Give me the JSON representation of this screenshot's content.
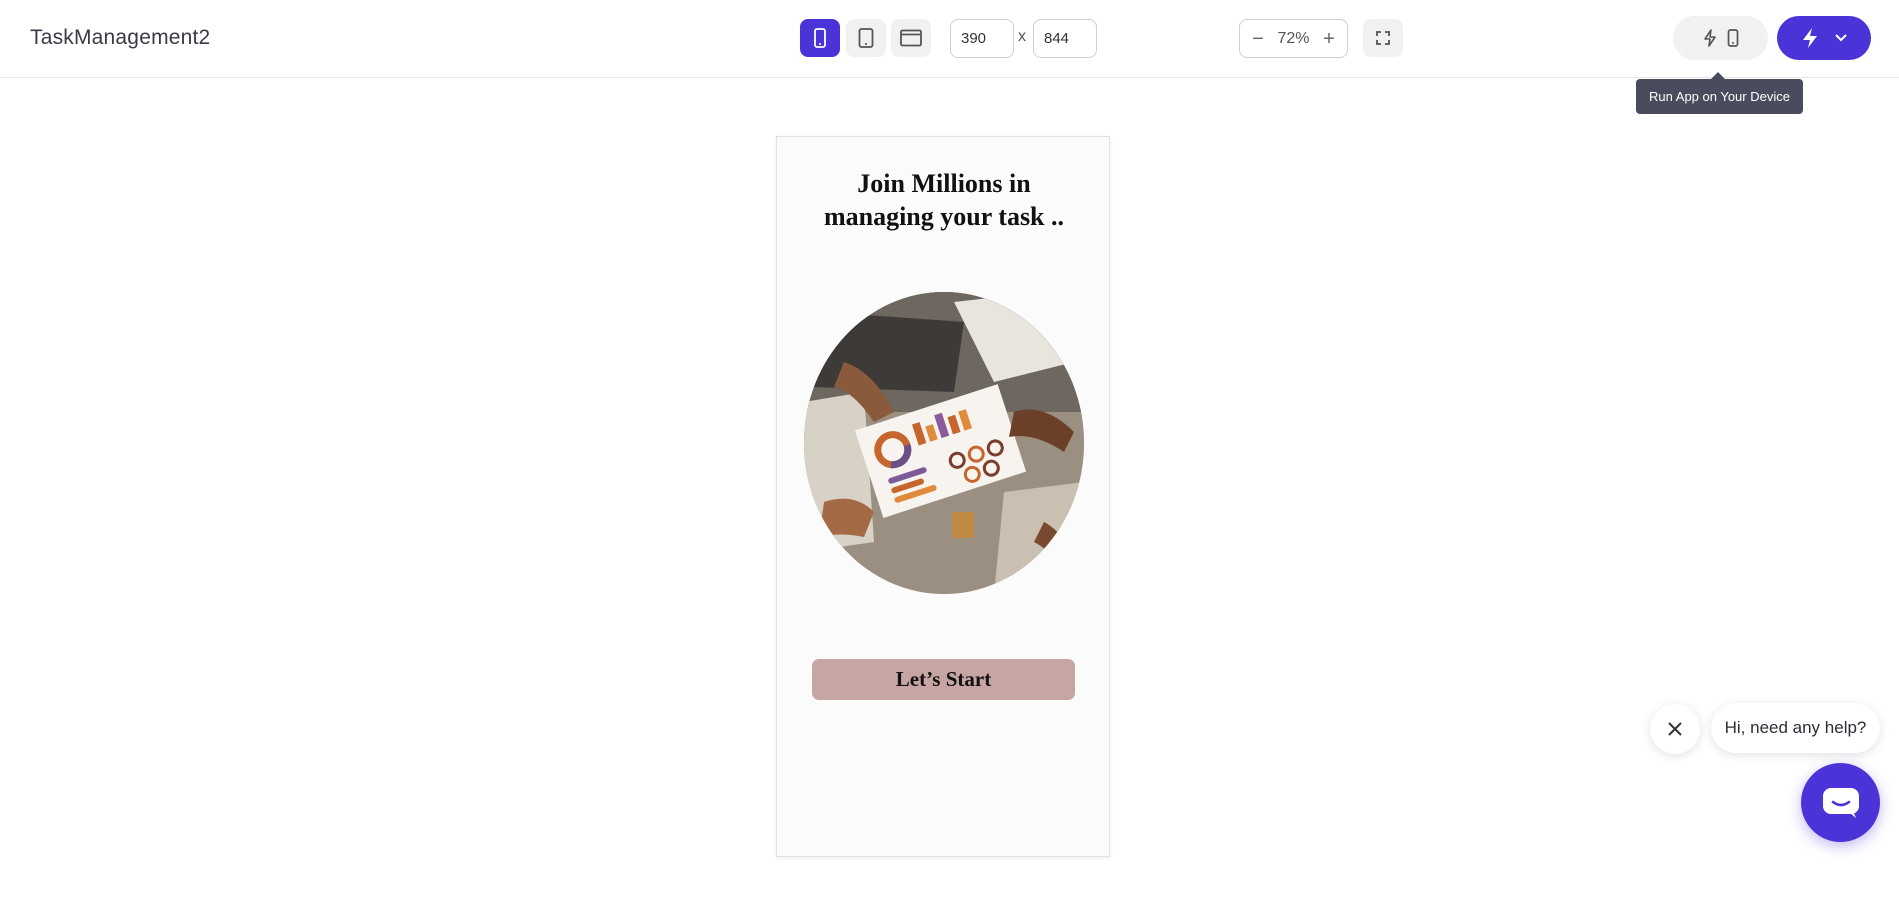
{
  "app": {
    "title": "TaskManagement2"
  },
  "toolbar": {
    "device_buttons": [
      {
        "icon": "phone-icon",
        "active": true
      },
      {
        "icon": "tablet-icon",
        "active": false
      },
      {
        "icon": "desktop-icon",
        "active": false
      }
    ],
    "width_value": "390",
    "height_value": "844",
    "size_separator": "x",
    "zoom": {
      "minus": "−",
      "value": "72%",
      "plus": "+"
    },
    "fullscreen_icon": "fullscreen-icon",
    "run_device_icons": [
      "bolt-icon",
      "phone-icon"
    ],
    "run_main_icons": [
      "bolt-icon",
      "chevron-down-icon"
    ],
    "accent_color": "#4a34d8"
  },
  "tooltip": {
    "text": "Run App on Your Device"
  },
  "preview": {
    "title_line1": "Join Millions in",
    "title_line2": "managing your task  ..",
    "button_label": "Let’s Start",
    "button_color": "#c7a5a3"
  },
  "chat": {
    "greeting": "Hi, need any help?",
    "close_icon": "close-icon",
    "fab_icon": "chat-icon"
  }
}
